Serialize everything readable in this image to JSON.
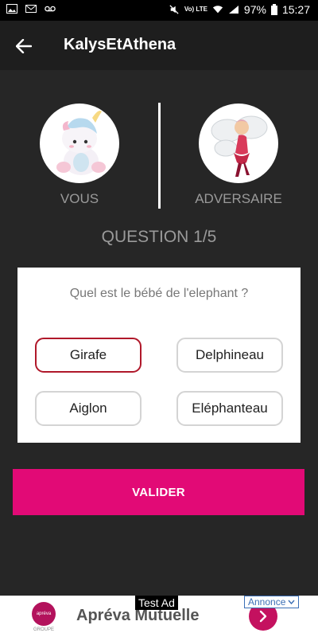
{
  "status_bar": {
    "battery": "97%",
    "time": "15:27",
    "network": "Vo) LTE"
  },
  "header": {
    "title": "KalysEtAthena"
  },
  "players": {
    "you_label": "VOUS",
    "opponent_label": "ADVERSAIRE"
  },
  "quiz": {
    "counter": "QUESTION 1/5",
    "question": "Quel est le bébé de l'elephant ?",
    "answers": [
      "Girafe",
      "Delphineau",
      "Aiglon",
      "Eléphanteau"
    ],
    "selected_answer": "Girafe"
  },
  "actions": {
    "validate_label": "VALIDER"
  },
  "ad": {
    "test_label": "Test Ad",
    "adchoices_label": "Annonce",
    "advertiser_name": "Apréva Mutuelle",
    "logo_text": "apréva",
    "logo_subtext": "GROUPE"
  },
  "colors": {
    "background": "#262626",
    "app_bar": "#1e1e1e",
    "accent": "#e20a76",
    "selected_border": "#b0182a"
  }
}
